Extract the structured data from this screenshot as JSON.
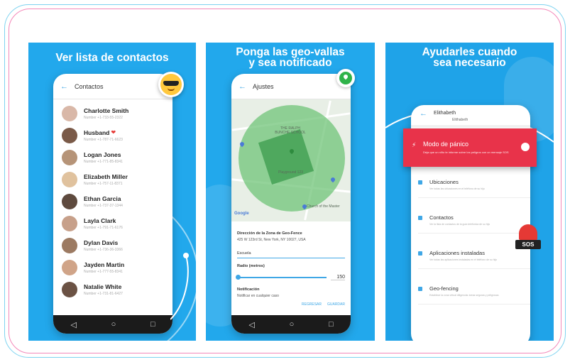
{
  "panel1": {
    "title": "Ver lista de contactos",
    "screen_title": "Contactos",
    "contacts": [
      {
        "name": "Charlotte Smith",
        "sub": "Number   +1-733-55-2322",
        "color": "#d9b8a8"
      },
      {
        "name": "Husband",
        "sub": "Number   +1-787-71-6623",
        "color": "#7a5a48",
        "heart": "❤"
      },
      {
        "name": "Logan Jones",
        "sub": "Number   +1-771-85-8341",
        "color": "#b69478"
      },
      {
        "name": "Elizabeth Miller",
        "sub": "Number   +1-757-11-8371",
        "color": "#e0c29e"
      },
      {
        "name": "Ethan Garcia",
        "sub": "Number   +1-737-37-1344",
        "color": "#5e4a3e"
      },
      {
        "name": "Layla Clark",
        "sub": "Number   +1-791-71-6176",
        "color": "#c7a08a"
      },
      {
        "name": "Dylan Davis",
        "sub": "Number   +1-736-36-3366",
        "color": "#9c7a62"
      },
      {
        "name": "Jayden Martin",
        "sub": "Number   +1-777-55-8341",
        "color": "#d0a488"
      },
      {
        "name": "Natalie White",
        "sub": "Number   +1-731-81-6427",
        "color": "#6b5244"
      }
    ]
  },
  "panel2": {
    "title_line1": "Ponga las geo-vallas",
    "title_line2": "y sea notificado",
    "screen_title": "Ajustes",
    "map_labels": {
      "school": "THE RALPH BUNCHE SCHOOL",
      "playground": "Playground 123",
      "church": "Church of the Master",
      "google": "Google"
    },
    "address_label": "Dirección de la Zona de Geo-Fence",
    "address_value": "425 W 123rd St, New York, NY 10027, USA",
    "name_value": "Escuela",
    "radius_label": "Radio (metros)",
    "radius_value": "150",
    "notification_label": "Notificación",
    "notification_value": "Notificar en cualquier caso",
    "back_button": "REGRESAR",
    "save_button": "GUARDAR"
  },
  "panel3": {
    "title_line1": "Ayudarles cuando",
    "title_line2": "sea necesario",
    "screen_title": "Elithabeth",
    "screen_subtitle": "Elithabeth",
    "panic_title": "Modo de pánico",
    "panic_desc": "Deja que un niño te informe sobre los peligros con un mensaje SOS",
    "options": [
      {
        "title": "Ubicaciones",
        "desc": "Ver todas las ubicaciones en el teléfono de su hijo"
      },
      {
        "title": "Contactos",
        "desc": "Ver la lista de contactos de la guía telefónica de su hijo"
      },
      {
        "title": "Aplicaciones instaladas",
        "desc": "Ver todas las aplicaciones instaladas en el teléfono de su hijo"
      },
      {
        "title": "Geo-fencing",
        "desc": "Establece la zona virtual diligenciar áreas seguras y peligrosas"
      }
    ],
    "sos_text": "SOS"
  },
  "colors": {
    "panel_blue": "#22a8ec",
    "accent": "#3fa7e6",
    "panic_red": "#e8334a"
  }
}
